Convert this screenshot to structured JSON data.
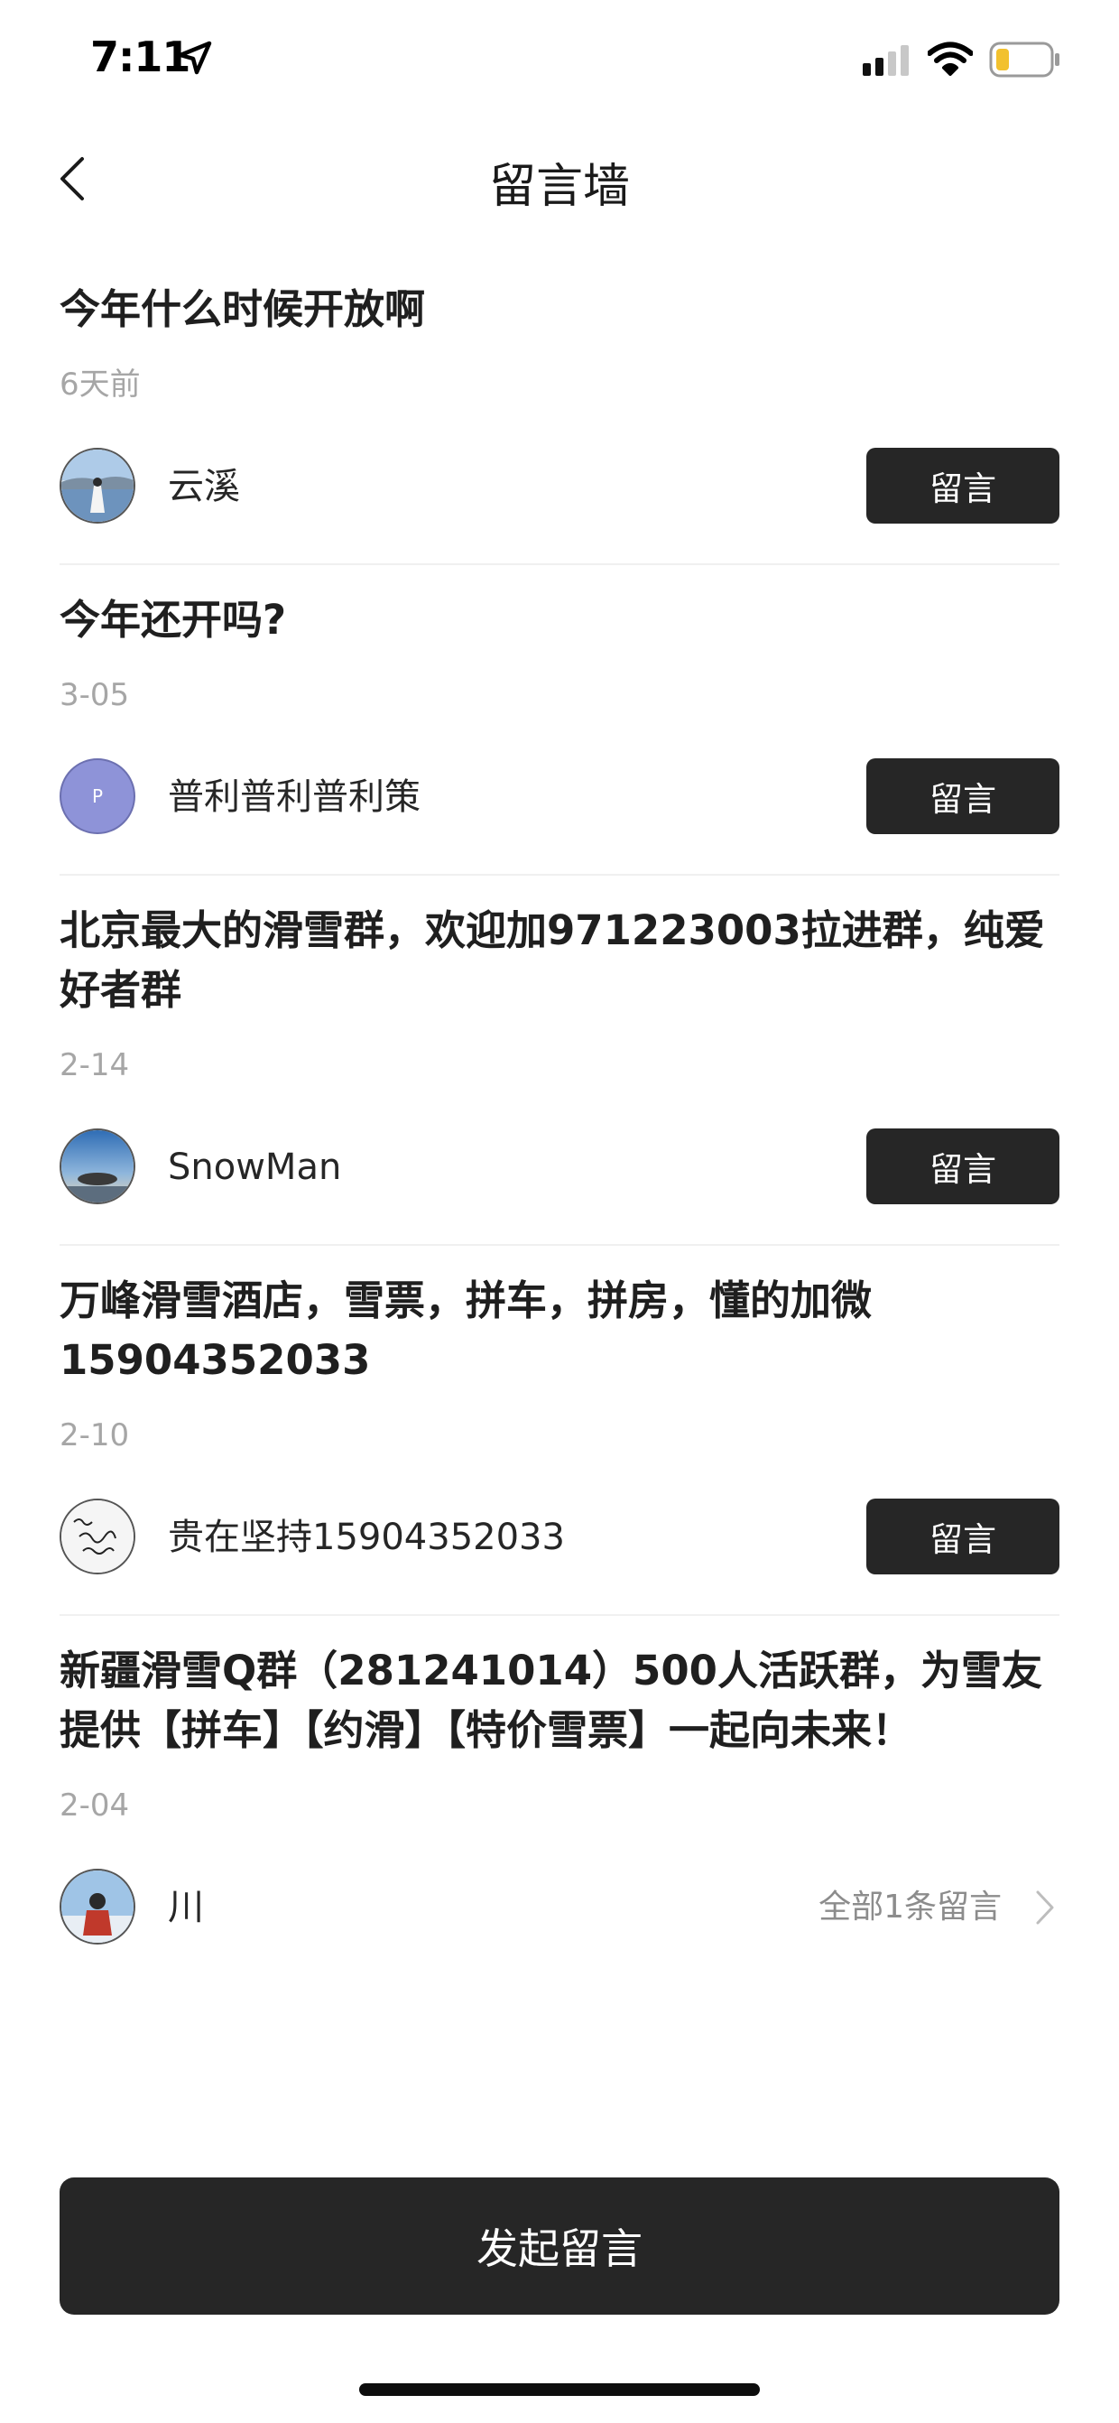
{
  "status_bar": {
    "time": "7:11"
  },
  "nav": {
    "title": "留言墙"
  },
  "posts": [
    {
      "title": "今年什么时候开放啊",
      "time": "6天前",
      "author": "云溪",
      "action": "留言",
      "avatar_letter": ""
    },
    {
      "title": "今年还开吗?",
      "time": "3-05",
      "author": "普利普利普利策",
      "action": "留言",
      "avatar_letter": "P"
    },
    {
      "title": "北京最大的滑雪群，欢迎加971223003拉进群，纯爱好者群",
      "time": "2-14",
      "author": "SnowMan",
      "action": "留言"
    },
    {
      "title": "万峰滑雪酒店，雪票，拼车，拼房，懂的加微15904352033",
      "time": "2-10",
      "author": "贵在坚持15904352033",
      "action": "留言"
    },
    {
      "title": "新疆滑雪Q群（281241014）500人活跃群，为雪友提供【拼车】【约滑】【特价雪票】一起向未来！",
      "time": "2-04",
      "author": "川",
      "replies": "全部1条留言"
    }
  ],
  "compose": {
    "label": "发起留言"
  },
  "colors": {
    "button_bg": "#262626",
    "muted_text": "#a6a6a6",
    "divider": "#f0f0f0",
    "avatar_letter_bg": "#8e93d8"
  },
  "icons": [
    "location-arrow-icon",
    "signal-icon",
    "wifi-icon",
    "battery-icon",
    "back-chevron-icon",
    "chevron-right-icon"
  ]
}
